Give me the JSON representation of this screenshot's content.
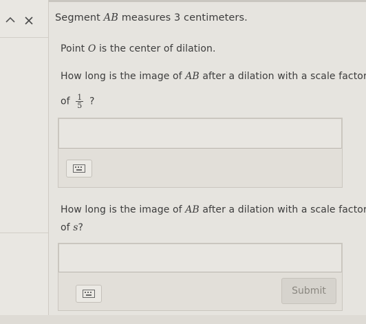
{
  "nav": {
    "back_icon": "chevron-back-icon",
    "close_icon": "close-icon"
  },
  "problem": {
    "title_prefix": "Segment ",
    "title_segment": "AB",
    "title_mid": " measures ",
    "title_value": "3",
    "title_suffix": " centimeters.",
    "center_prefix": "Point ",
    "center_point": "O",
    "center_suffix": " is the center of dilation."
  },
  "question1": {
    "line1_prefix": "How long is the image of ",
    "line1_segment": "AB",
    "line1_suffix": " after a dilation with a scale factor",
    "line2_prefix": "of",
    "fraction_numerator": "1",
    "fraction_denominator": "5",
    "line2_suffix": "?",
    "input_value": ""
  },
  "question2": {
    "line1_prefix": "How long is the image of ",
    "line1_segment": "AB",
    "line1_suffix": " after a dilation with a scale factor",
    "line2_prefix": "of ",
    "scale_var": "s",
    "line2_suffix": "?",
    "input_value": ""
  },
  "actions": {
    "submit_label": "Submit",
    "keyboard_icon": "keyboard-icon"
  },
  "colors": {
    "background": "#e6e4df",
    "text": "#3c3c3c",
    "submit_bg": "#d6d3cd"
  }
}
